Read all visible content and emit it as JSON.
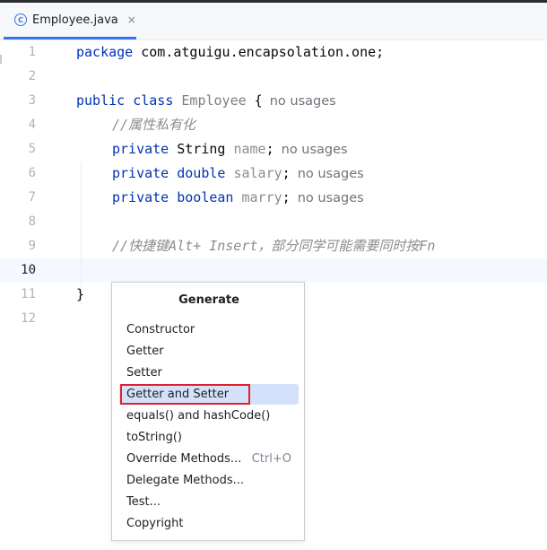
{
  "tab": {
    "title": "Employee.java",
    "icon": "class-c-icon",
    "icon_letter": "C",
    "close_glyph": "×"
  },
  "line_numbers": [
    "1",
    "2",
    "3",
    "4",
    "5",
    "6",
    "7",
    "8",
    "9",
    "10",
    "11",
    "12"
  ],
  "active_line": "10",
  "code": {
    "l1_kw": "package",
    "l1_rest": " com.atguigu.encapsolation.one;",
    "l3_kw": "public class",
    "l3_cls": "Employee",
    "l3_brace": " {",
    "l3_hint": "no usages",
    "l4_comment": "//属性私有化",
    "l5_kw": "private",
    "l5_type": " String ",
    "l5_field": "name",
    "l5_semi": ";",
    "l5_hint": "no usages",
    "l6_kw": "private double",
    "l6_field": "salary",
    "l6_semi": ";",
    "l6_hint": "no usages",
    "l7_kw": "private boolean",
    "l7_field": "marry",
    "l7_semi": ";",
    "l7_hint": "no usages",
    "l9_comment": "//快捷键Alt+ Insert，部分同学可能需要同时按Fn",
    "l11_brace": "}"
  },
  "generate_menu": {
    "title": "Generate",
    "items": [
      {
        "label": "Constructor",
        "shortcut": ""
      },
      {
        "label": "Getter",
        "shortcut": ""
      },
      {
        "label": "Setter",
        "shortcut": ""
      },
      {
        "label": "Getter and Setter",
        "shortcut": "",
        "selected": true
      },
      {
        "label": "equals() and hashCode()",
        "shortcut": ""
      },
      {
        "label": "toString()",
        "shortcut": ""
      },
      {
        "label": "Override Methods...",
        "shortcut": "Ctrl+O"
      },
      {
        "label": "Delegate Methods...",
        "shortcut": ""
      },
      {
        "label": "Test...",
        "shortcut": ""
      },
      {
        "label": "Copyright",
        "shortcut": ""
      }
    ]
  },
  "colors": {
    "keyword": "#0033b3",
    "selection": "#d5e1fb",
    "annotation_box": "#e0202b",
    "tab_underline": "#3574f0"
  }
}
